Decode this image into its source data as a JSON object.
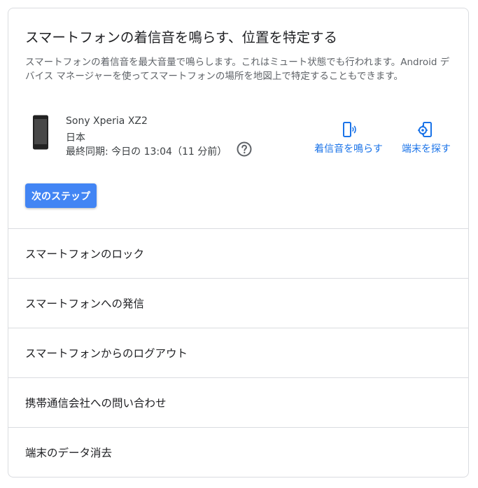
{
  "card": {
    "title": "スマートフォンの着信音を鳴らす、位置を特定する",
    "description": "スマートフォンの着信音を最大音量で鳴らします。これはミュート状態でも行われます。Android デバイス マネージャーを使ってスマートフォンの場所を地図上で特定することもできます。"
  },
  "device": {
    "name": "Sony Xperia XZ2",
    "country": "日本",
    "last_sync": "最終同期: 今日の 13:04（11 分前）"
  },
  "actions": {
    "ring_label": "着信音を鳴らす",
    "find_label": "端末を探す"
  },
  "next_button": "次のステップ",
  "list": [
    {
      "label": "スマートフォンのロック"
    },
    {
      "label": "スマートフォンへの発信"
    },
    {
      "label": "スマートフォンからのログアウト"
    },
    {
      "label": "携帯通信会社への問い合わせ"
    },
    {
      "label": "端末のデータ消去"
    }
  ],
  "colors": {
    "accent": "#1a73e8",
    "button": "#4285f4",
    "divider": "#dadce0"
  },
  "icons": [
    "phone-image",
    "help-icon",
    "ring-phone-icon",
    "find-device-icon"
  ]
}
